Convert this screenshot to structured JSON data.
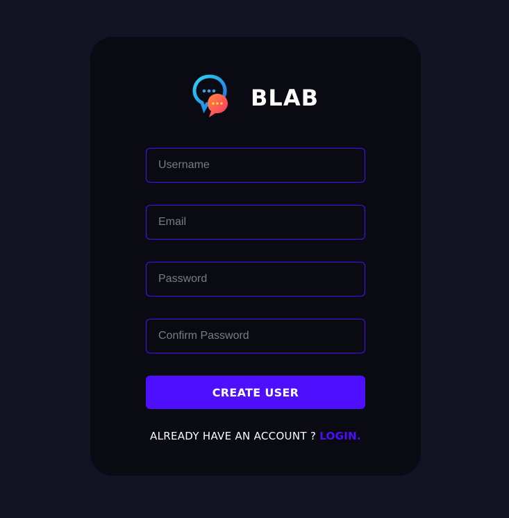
{
  "brand": {
    "name": "BLAB",
    "logo_icon": "chat-bubbles-icon"
  },
  "form": {
    "username": {
      "placeholder": "Username",
      "value": ""
    },
    "email": {
      "placeholder": "Email",
      "value": ""
    },
    "password": {
      "placeholder": "Password",
      "value": ""
    },
    "confirm_password": {
      "placeholder": "Confirm Password",
      "value": ""
    },
    "submit_label": "CREATE USER"
  },
  "footer": {
    "prompt": "ALREADY HAVE AN ACCOUNT ?",
    "login_label": "LOGIN."
  },
  "colors": {
    "page_background": "#131324",
    "card_background": "#0a0a13",
    "accent": "#4e0eff",
    "text": "#ffffff",
    "placeholder": "#7c7c85"
  }
}
